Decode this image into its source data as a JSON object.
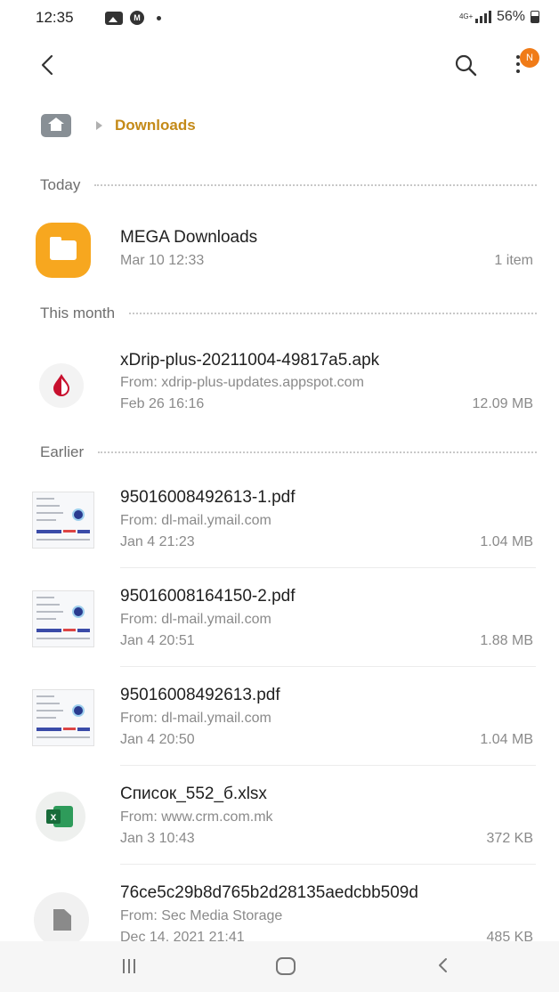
{
  "status_bar": {
    "time": "12:35",
    "network": "4G+",
    "battery": "56%",
    "battery_level": 0.56
  },
  "toolbar": {
    "notification_badge": "N",
    "badge_color": "#f07b17"
  },
  "breadcrumb": {
    "current": "Downloads",
    "accent_color": "#c48a18"
  },
  "sections": {
    "today": "Today",
    "this_month": "This month",
    "earlier": "Earlier"
  },
  "items": [
    {
      "title": "MEGA Downloads",
      "date": "Mar 10 12:33",
      "meta": "1 item",
      "icon": "folder-icon"
    },
    {
      "title": "xDrip-plus-20211004-49817a5.apk",
      "source": "From: xdrip-plus-updates.appspot.com",
      "date": "Feb 26 16:16",
      "meta": "12.09 MB",
      "icon": "xdrip-app-icon"
    },
    {
      "title": "95016008492613-1.pdf",
      "source": "From: dl-mail.ymail.com",
      "date": "Jan 4 21:23",
      "meta": "1.04 MB",
      "icon": "pdf-thumbnail"
    },
    {
      "title": "95016008164150-2.pdf",
      "source": "From: dl-mail.ymail.com",
      "date": "Jan 4 20:51",
      "meta": "1.88 MB",
      "icon": "pdf-thumbnail"
    },
    {
      "title": "95016008492613.pdf",
      "source": "From: dl-mail.ymail.com",
      "date": "Jan 4 20:50",
      "meta": "1.04 MB",
      "icon": "pdf-thumbnail"
    },
    {
      "title": "Список_552_б.xlsx",
      "source": "From: www.crm.com.mk",
      "date": "Jan 3 10:43",
      "meta": "372 KB",
      "icon": "excel-icon"
    },
    {
      "title": "76ce5c29b8d765b2d28135aedcbb509d",
      "source": "From: Sec Media Storage",
      "date": "Dec 14, 2021 21:41",
      "meta": "485 KB",
      "icon": "generic-file-icon"
    }
  ]
}
